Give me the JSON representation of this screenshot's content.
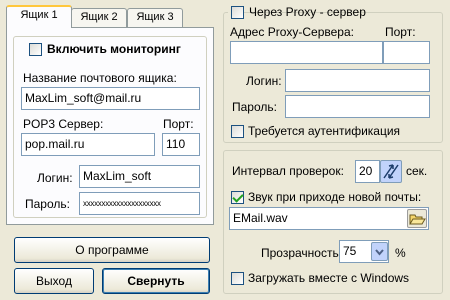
{
  "tabs": [
    "Ящик 1",
    "Ящик 2",
    "Ящик 3"
  ],
  "mailbox": {
    "enable_label": "Включить мониторинг",
    "enabled": false,
    "name_label": "Название почтового ящика:",
    "name_value": "MaxLim_soft@mail.ru",
    "pop3_label": "POP3 Сервер:",
    "port_label": "Порт:",
    "pop3_value": "pop.mail.ru",
    "port_value": "110",
    "login_label": "Логин:",
    "login_value": "MaxLim_soft",
    "password_label": "Пароль:",
    "password_value": "xxxxxxxxxxxxxxxxxxxxx"
  },
  "buttons": {
    "about": "О программе",
    "exit": "Выход",
    "minimize": "Свернуть"
  },
  "proxy": {
    "enable_label": "Через Proxy - сервер",
    "enabled": false,
    "address_label": "Адрес Proxy-Сервера:",
    "port_label": "Порт:",
    "address_value": "",
    "port_value": "",
    "login_label": "Логин:",
    "login_value": "",
    "password_label": "Пароль:",
    "password_value": "",
    "auth_label": "Требуется аутентификация",
    "auth_required": false
  },
  "settings": {
    "interval_label": "Интервал проверок:",
    "interval_value": "20",
    "interval_unit": "сек.",
    "sound_label": "Звук при приходе новой почты:",
    "sound_enabled": true,
    "sound_file": "EMail.wav",
    "transparency_label": "Прозрачность:",
    "transparency_value": "75",
    "transparency_unit": "%",
    "autostart_label": "Загружать вместе с Windows",
    "autostart_enabled": false
  },
  "colors": {
    "window_bg": "#ece9d8",
    "panel_bg": "#fcfcfe",
    "input_border": "#7f9db9",
    "button_border": "#003c74",
    "active_tab_accent": "#ffc73c",
    "check_mark": "#21a121"
  }
}
